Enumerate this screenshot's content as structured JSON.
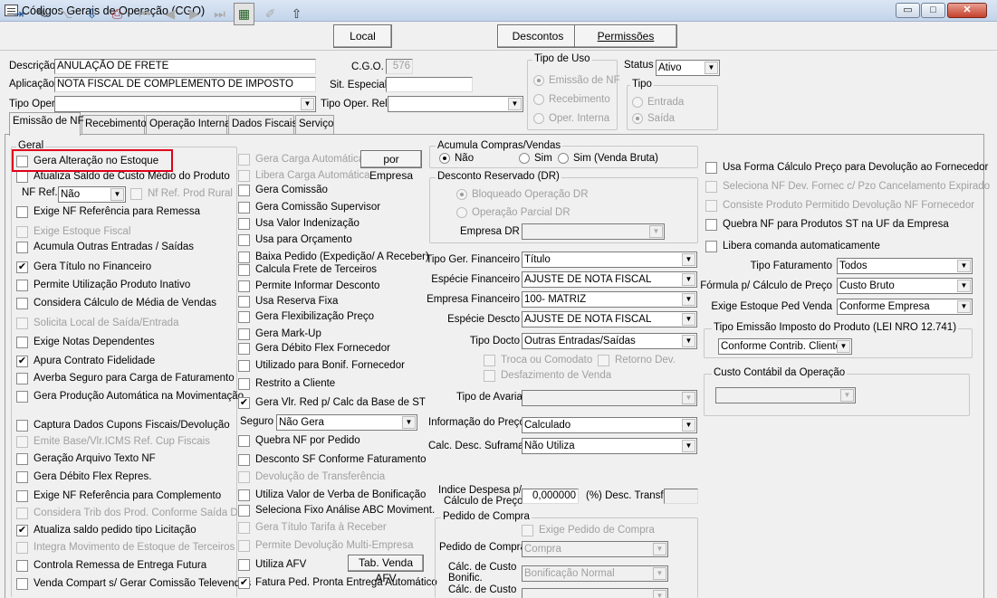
{
  "window": {
    "title": "Códigos Gerais de Operação (CGO)",
    "min": "▭",
    "max": "□",
    "close": "✕"
  },
  "toolbar": {
    "icons": [
      "exit-icon",
      "erase-icon",
      "flowchart-icon",
      "save-download-icon",
      "print-icon",
      "first-record-icon",
      "prev-record-icon",
      "next-record-icon",
      "last-record-icon",
      "grid-view-icon",
      "edit-icon",
      "upload-icon"
    ],
    "glyphs": {
      "exit": "⇥",
      "erase": "✎",
      "flow": "⌥",
      "save": "⇩",
      "print": "⎙",
      "first": "⏮",
      "prev": "◀",
      "next": "▶",
      "last": "⏭",
      "grid": "▦",
      "edit": "✐",
      "upload": "⇧"
    },
    "local": "Local",
    "descontos": "Descontos",
    "permissoes": "Permissões"
  },
  "header": {
    "descricao_label": "Descrição",
    "descricao": "ANULAÇÃO DE FRETE",
    "cgo_label": "C.G.O.",
    "cgo": "576",
    "aplicacao_label": "Aplicação",
    "aplicacao": "NOTA FISCAL DE COMPLEMENTO DE IMPOSTO",
    "sit_label": "Sit. Especial",
    "sit": "",
    "tipo_oper_label": "Tipo Oper.",
    "tipo_oper": "",
    "tipo_oper_rel_label": "Tipo Oper. Rel.",
    "tipo_oper_rel": "",
    "tipo_uso": {
      "title": "Tipo de Uso",
      "opts": [
        "Emissão de NF",
        "Recebimento",
        "Oper. Interna"
      ]
    },
    "status_label": "Status",
    "status": "Ativo",
    "tipo": {
      "title": "Tipo",
      "opts": [
        "Entrada",
        "Saída"
      ]
    }
  },
  "tabs": [
    "Emissão de NF",
    "Recebimento",
    "Operação Interna",
    "Dados Fiscais",
    "Serviço"
  ],
  "col1": {
    "group": "Geral",
    "items": [
      "Gera Alteração no Estoque",
      "Atualiza Saldo de Custo Médio do Produto"
    ],
    "nf_ref_label": "NF Ref.",
    "nf_ref": "Não",
    "nf_ref_prod": "Nf Ref. Prod Rural",
    "items2": [
      "Exige NF Referência para Remessa",
      "Exige Estoque Fiscal",
      "Acumula Outras Entradas / Saídas",
      "Gera Título no Financeiro",
      "Permite Utilização Produto Inativo",
      "Considera Cálculo de Média de Vendas",
      "Solicita Local de Saída/Entrada",
      "Exige Notas Dependentes",
      "Apura Contrato Fidelidade",
      "Averba Seguro para Carga de Faturamento",
      "Gera Produção Automática na Movimentação",
      "Captura Dados Cupons Fiscais/Devolução",
      "Emite Base/Vlr.ICMS Ref. Cup Fiscais",
      "Geração Arquivo Texto NF",
      "Gera Débito Flex Repres.",
      "Exige NF Referência para Complemento",
      "Considera Trib dos Prod. Conforme Saída Dev.",
      "Atualiza saldo pedido tipo Licitação",
      "Integra Movimento de Estoque de Terceiros",
      "Controla Remessa de Entrega Futura",
      "Venda Compart s/ Gerar Comissão Televendas"
    ]
  },
  "col2": {
    "items": [
      "Gera Carga Automática",
      "Libera Carga Automática",
      "Gera Comissão",
      "Gera Comissão Supervisor",
      "Usa Valor Indenização",
      "Usa para Orçamento",
      "Baixa Pedido (Expedição/ A Receber)",
      "Calcula Frete de Terceiros",
      "Permite Informar Desconto",
      "Usa Reserva Fixa",
      "Gera Flexibilização Preço",
      "Gera Mark-Up",
      "Gera Débito Flex Fornecedor",
      "Utilizado para Bonif. Fornecedor",
      "Restrito a Cliente",
      "Gera Vlr. Red p/ Calc da Base de ST"
    ],
    "por_empresa": "por Empresa",
    "seguro_label": "Seguro",
    "seguro": "Não Gera",
    "items2": [
      "Quebra NF por Pedido",
      "Desconto SF Conforme Faturamento",
      "Devolução de Transferência",
      "Utiliza Valor de Verba de Bonificação",
      "Seleciona Fixo Análise ABC Moviment.",
      "Gera Título Tarifa à Receber",
      "Permite Devolução Multi-Empresa",
      "Utiliza AFV",
      "Fatura Ped. Pronta Entrega Automático"
    ],
    "tab_venda": "Tab. Venda AFV"
  },
  "col3": {
    "acum": {
      "title": "Acumula Compras/Vendas",
      "opts": [
        "Não",
        "Sim",
        "Sim (Venda Bruta)"
      ]
    },
    "desc": {
      "title": "Desconto Reservado (DR)",
      "opts": [
        "Bloqueado Operação DR",
        "Operação Parcial DR"
      ],
      "empresa_dr_label": "Empresa DR",
      "empresa_dr": ""
    },
    "fields": [
      {
        "label": "Tipo Ger. Financeiro",
        "value": "Título"
      },
      {
        "label": "Espécie Financeiro",
        "value": "AJUSTE DE NOTA FISCAL"
      },
      {
        "label": "Empresa Financeiro",
        "value": "100- MATRIZ"
      },
      {
        "label": "Espécie Descto",
        "value": "AJUSTE DE NOTA FISCAL"
      },
      {
        "label": "Tipo Docto",
        "value": "Outras Entradas/Saídas"
      }
    ],
    "troca": "Troca ou Comodato",
    "retorno": "Retorno Dev.",
    "desfaz": "Desfazimento de Venda",
    "tipo_avaria_label": "Tipo de Avaria",
    "info_preco_label": "Informação do Preço",
    "info_preco": "Calculado",
    "calc_desc_label": "Calc. Desc. Suframa",
    "calc_desc": "Não Utiliza",
    "indice_label1": "Indice Despesa p/",
    "indice_label2": "Cálculo de Preço",
    "indice": "0,000000",
    "desc_transf": "(%) Desc. Transf.",
    "pedido": {
      "title": "Pedido de Compra",
      "exige": "Exige Pedido de Compra",
      "pedido_label": "Pedido de Compra",
      "pedido": "Compra",
      "bonif_label1": "Cálc. de Custo",
      "bonif_label2": "Bonific.",
      "bonif": "Bonificação Normal",
      "calc2": "Cálc. de Custo"
    }
  },
  "col4": {
    "items": [
      "Usa Forma Cálculo Preço para Devolução ao Fornecedor",
      "Seleciona NF Dev. Fornec c/ Pzo Cancelamento Expirado",
      "Consiste Produto Permitido Devolução NF Fornecedor",
      "Quebra NF para Produtos ST na UF da Empresa",
      "Libera comanda automaticamente"
    ],
    "fields": [
      {
        "label": "Tipo Faturamento",
        "value": "Todos"
      },
      {
        "label": "Fórmula p/ Cálculo de Preço",
        "value": "Custo Bruto"
      },
      {
        "label": "Exige Estoque Ped Venda",
        "value": "Conforme Empresa"
      }
    ],
    "emissao": {
      "title": "Tipo Emissão Imposto do Produto (LEI NRO 12.741)",
      "value": "Conforme Contrib. Cliente"
    },
    "custo": {
      "title": "Custo Contábil da Operação",
      "value": ""
    }
  },
  "check": "✔",
  "arrow": "▼"
}
